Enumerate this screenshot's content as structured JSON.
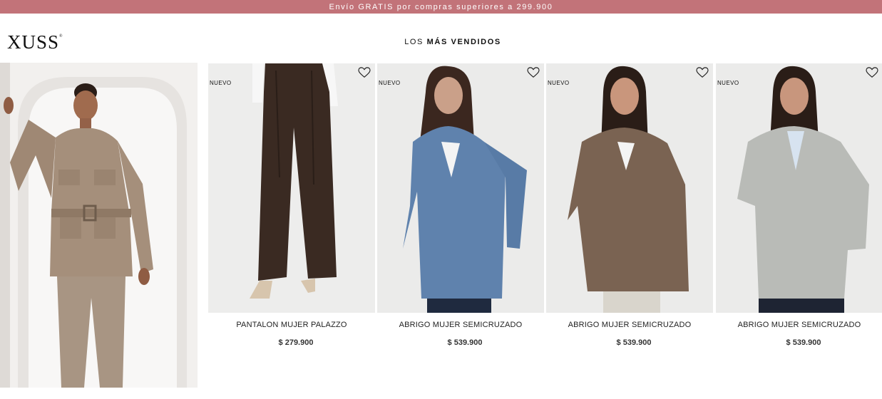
{
  "promo": {
    "text": "Envío GRATIS por compras superiores a 299.900"
  },
  "brand": {
    "name": "XUSS"
  },
  "section": {
    "title_prefix": "LOS",
    "title_bold": "MÁS VENDIDOS"
  },
  "products": [
    {
      "badge": "NUEVO",
      "name": "PANTALON MUJER PALAZZO",
      "price": "$ 279.900"
    },
    {
      "badge": "NUEVO",
      "name": "ABRIGO MUJER SEMICRUZADO",
      "price": "$ 539.900"
    },
    {
      "badge": "NUEVO",
      "name": "ABRIGO MUJER SEMICRUZADO",
      "price": "$ 539.900"
    },
    {
      "badge": "NUEVO",
      "name": "ABRIGO MUJER SEMICRUZADO",
      "price": "$ 539.900"
    }
  ],
  "colors": {
    "promo_bg": "#c27379",
    "coat_blue": "#5f82ad",
    "coat_brown": "#7a6352",
    "coat_grey": "#b9bbb7",
    "pants_brown": "#3a2a22"
  }
}
